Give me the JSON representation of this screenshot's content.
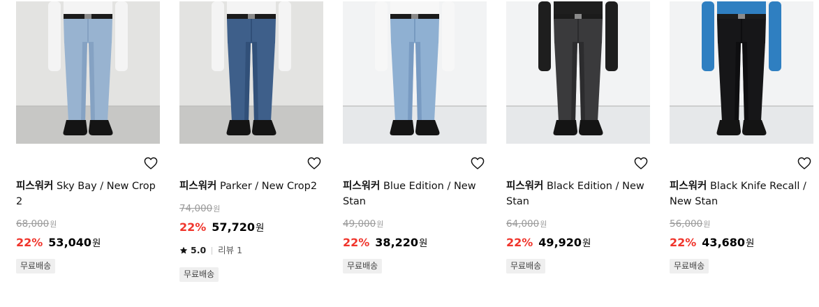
{
  "currency_unit": "원",
  "products": [
    {
      "brand": "피스워커",
      "name": "Sky Bay / New Crop 2",
      "original_price": "68,000",
      "discount": "22%",
      "price": "53,040",
      "badge": "무료배송",
      "image": {
        "wall": "#e3e3e1",
        "floor": "#c7c7c5",
        "jeans": "#98b3d0",
        "jeans_shade": "#7d9bbd",
        "shirt": "#f4f4f4",
        "shoes": "#141414"
      }
    },
    {
      "brand": "피스워커",
      "name": "Parker / New Crop2",
      "original_price": "74,000",
      "discount": "22%",
      "price": "57,720",
      "rating": "5.0",
      "reviews": "리뷰 1",
      "badge": "무료배송",
      "image": {
        "wall": "#e3e3e1",
        "floor": "#c7c7c5",
        "jeans": "#3e5f8a",
        "jeans_shade": "#2c4a72",
        "shirt": "#f4f4f4",
        "shoes": "#141414"
      }
    },
    {
      "brand": "피스워커",
      "name": "Blue Edition / New Stan",
      "original_price": "49,000",
      "discount": "22%",
      "price": "38,220",
      "badge": "무료배송",
      "image": {
        "wall": "#f2f3f4",
        "floor": "#e6e8ea",
        "jeans": "#8fb0d2",
        "jeans_shade": "#6f93bb",
        "shirt": "#f7f7f7",
        "shoes": "#141414"
      }
    },
    {
      "brand": "피스워커",
      "name": "Black Edition / New Stan",
      "original_price": "64,000",
      "discount": "22%",
      "price": "49,920",
      "badge": "무료배송",
      "image": {
        "wall": "#f2f3f4",
        "floor": "#e6e8ea",
        "jeans": "#3a3a3c",
        "jeans_shade": "#262628",
        "shirt": "#1e1e1e",
        "shoes": "#141414"
      }
    },
    {
      "brand": "피스워커",
      "name": "Black Knife Recall / New Stan",
      "original_price": "56,000",
      "discount": "22%",
      "price": "43,680",
      "badge": "무료배송",
      "image": {
        "wall": "#f2f3f4",
        "floor": "#e6e8ea",
        "jeans": "#161618",
        "jeans_shade": "#0c0c0d",
        "shirt": "#2f7fc1",
        "shoes": "#141414"
      }
    }
  ]
}
